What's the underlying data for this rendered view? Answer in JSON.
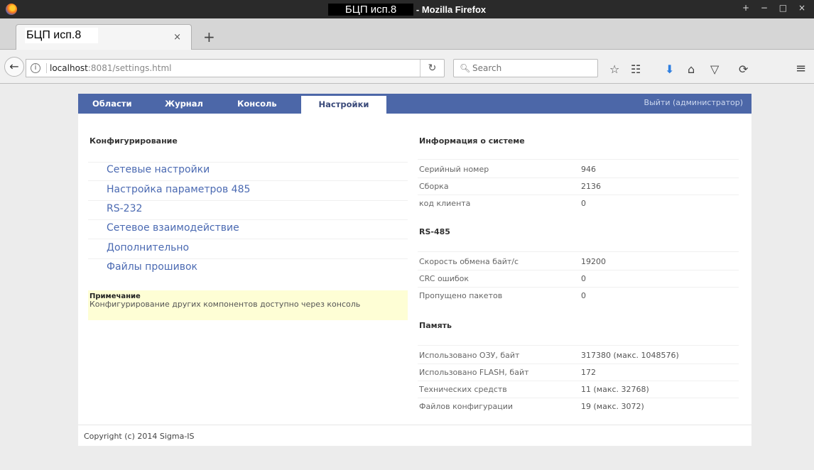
{
  "window": {
    "title_highlight": "БЦП исп.8",
    "title_suffix": " - Mozilla Firefox",
    "controls": "+ − □ ×"
  },
  "tab": {
    "label": "БЦП исп.8",
    "close": "×",
    "new_tab": "+"
  },
  "navbar": {
    "url_host": "localhost",
    "url_rest": ":8081/settings.html",
    "search_placeholder": "Search",
    "icons": [
      "bookmark-star-icon",
      "reading-list-icon",
      "download-icon",
      "home-icon",
      "pocket-icon",
      "sync-icon",
      "menu-icon"
    ]
  },
  "menu": {
    "items": [
      "Области",
      "Журнал",
      "Консоль",
      "Настройки"
    ],
    "active": "Настройки",
    "logout": "Выйти (администратор)"
  },
  "config": {
    "title": "Конфигурирование",
    "links": [
      "Сетевые настройки",
      "Настройка параметров 485",
      "RS-232",
      "Сетевое взаимодействие",
      "Дополнительно",
      "Файлы прошивок"
    ],
    "note_title": "Примечание",
    "note_text": "Конфигурирование других компонентов доступно через консоль"
  },
  "system": {
    "title": "Информация о системе",
    "rows": [
      {
        "label": "Серийный номер",
        "value": "946"
      },
      {
        "label": "Сборка",
        "value": "2136"
      },
      {
        "label": "код клиента",
        "value": "0"
      }
    ]
  },
  "rs485": {
    "title": "RS-485",
    "rows": [
      {
        "label": "Скорость обмена байт/с",
        "value": "19200"
      },
      {
        "label": "CRC ошибок",
        "value": "0"
      },
      {
        "label": "Пропущено пакетов",
        "value": "0"
      }
    ]
  },
  "memory": {
    "title": "Память",
    "rows": [
      {
        "label": "Использовано ОЗУ, байт",
        "value": "317380 (макс. 1048576)"
      },
      {
        "label": "Использовано FLASH, байт",
        "value": "172"
      },
      {
        "label": "Технических средств",
        "value": "11 (макс. 32768)"
      },
      {
        "label": "Файлов конфигурации",
        "value": "19 (макс. 3072)"
      }
    ]
  },
  "footer": {
    "copyright": "Copyright (c) 2014 Sigma-IS"
  }
}
